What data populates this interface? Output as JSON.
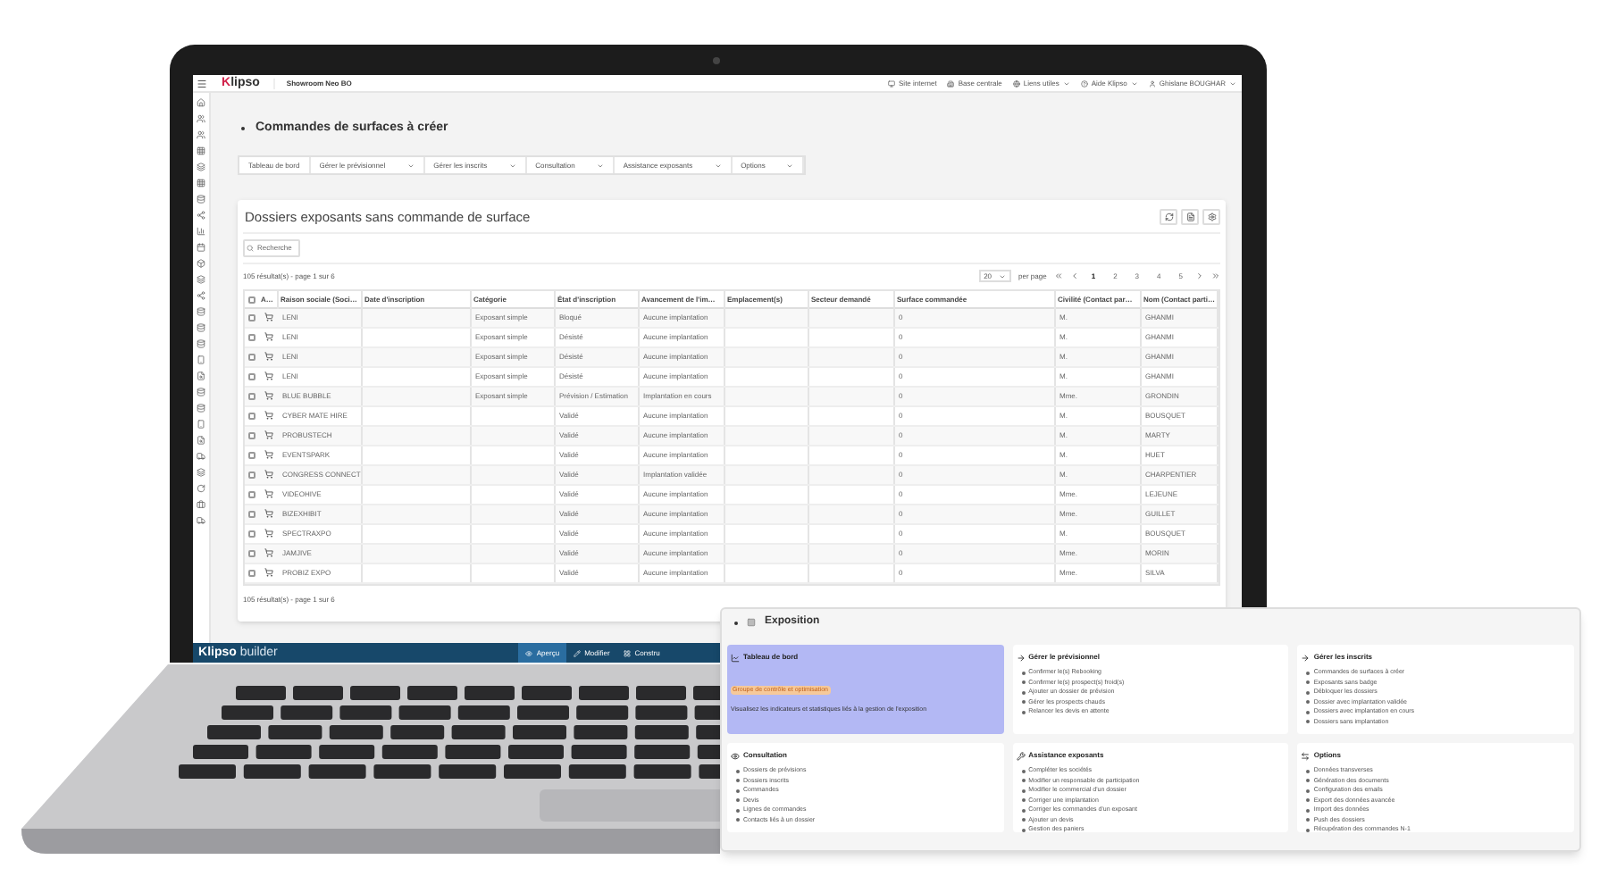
{
  "header": {
    "logo_initial": "K",
    "logo_rest": "lipso",
    "app_name": "Showroom Neo BO",
    "links": [
      {
        "label": "Site internet",
        "dropdown": false
      },
      {
        "label": "Base centrale",
        "dropdown": false
      },
      {
        "label": "Liens utiles",
        "dropdown": true
      },
      {
        "label": "Aide Klipso",
        "dropdown": true
      },
      {
        "label": "Ghislane BOUGHAR",
        "dropdown": true
      }
    ]
  },
  "page_title": "Commandes de surfaces à créer",
  "nav_tabs": [
    {
      "label": "Tableau de bord",
      "dropdown": false
    },
    {
      "label": "Gérer le prévisionnel",
      "dropdown": true
    },
    {
      "label": "Gérer les inscrits",
      "dropdown": true
    },
    {
      "label": "Consultation",
      "dropdown": true
    },
    {
      "label": "Assistance exposants",
      "dropdown": true
    },
    {
      "label": "Options",
      "dropdown": true
    }
  ],
  "card": {
    "title": "Dossiers exposants sans commande de surface",
    "search": {
      "placeholder": "Recherche"
    },
    "results": "105 résultat(s) - page 1 sur 6",
    "per_page": {
      "value": "20",
      "label": "per page"
    },
    "pages": [
      {
        "label": "1",
        "selected": true
      },
      {
        "label": "2",
        "selected": false
      },
      {
        "label": "3",
        "selected": false
      },
      {
        "label": "4",
        "selected": false
      },
      {
        "label": "5",
        "selected": false
      }
    ],
    "select_all": {
      "checked": false
    },
    "columns": [
      "A…",
      "Raison sociale (Soci…",
      "Date d'inscription",
      "Catégorie",
      "État d'inscription",
      "Avancement de l'im…",
      "Emplacement(s)",
      "Secteur demandé",
      "Surface commandée",
      "Civilité (Contact par…",
      "Nom (Contact parti…"
    ],
    "rows": [
      {
        "checked": false,
        "name": "LENI",
        "category": "Exposant simple",
        "status": "Bloqué",
        "progress": "Aucune implantation",
        "surface": "0",
        "civility": "M.",
        "contact": "GHANMI"
      },
      {
        "checked": false,
        "name": "LENI",
        "category": "Exposant simple",
        "status": "Désisté",
        "progress": "Aucune implantation",
        "surface": "0",
        "civility": "M.",
        "contact": "GHANMI"
      },
      {
        "checked": false,
        "name": "LENI",
        "category": "Exposant simple",
        "status": "Désisté",
        "progress": "Aucune implantation",
        "surface": "0",
        "civility": "M.",
        "contact": "GHANMI"
      },
      {
        "checked": false,
        "name": "LENI",
        "category": "Exposant simple",
        "status": "Désisté",
        "progress": "Aucune implantation",
        "surface": "0",
        "civility": "M.",
        "contact": "GHANMI"
      },
      {
        "checked": false,
        "name": "BLUE BUBBLE",
        "category": "Exposant simple",
        "status": "Prévision / Estimation",
        "progress": "Implantation en cours",
        "surface": "0",
        "civility": "Mme.",
        "contact": "GRONDIN"
      },
      {
        "checked": false,
        "name": "CYBER MATE HIRE",
        "status": "Validé",
        "progress": "Aucune implantation",
        "surface": "0",
        "civility": "M.",
        "contact": "BOUSQUET"
      },
      {
        "checked": false,
        "name": "PROBUSTECH",
        "status": "Validé",
        "progress": "Aucune implantation",
        "surface": "0",
        "civility": "M.",
        "contact": "MARTY"
      },
      {
        "checked": false,
        "name": "EVENTSPARK",
        "status": "Validé",
        "progress": "Aucune implantation",
        "surface": "0",
        "civility": "M.",
        "contact": "HUET"
      },
      {
        "checked": false,
        "name": "CONGRESS CONNECT",
        "status": "Validé",
        "progress": "Implantation validée",
        "surface": "0",
        "civility": "M.",
        "contact": "CHARPENTIER"
      },
      {
        "checked": false,
        "name": "VIDEOHIVE",
        "status": "Validé",
        "progress": "Aucune implantation",
        "surface": "0",
        "civility": "Mme.",
        "contact": "LEJEUNE"
      },
      {
        "checked": false,
        "name": "BIZEXHIBIT",
        "status": "Validé",
        "progress": "Aucune implantation",
        "surface": "0",
        "civility": "Mme.",
        "contact": "GUILLET"
      },
      {
        "checked": false,
        "name": "SPECTRAXPO",
        "status": "Validé",
        "progress": "Aucune implantation",
        "surface": "0",
        "civility": "M.",
        "contact": "BOUSQUET"
      },
      {
        "checked": false,
        "name": "JAMJIVE",
        "status": "Validé",
        "progress": "Aucune implantation",
        "surface": "0",
        "civility": "Mme.",
        "contact": "MORIN"
      },
      {
        "checked": false,
        "name": "PROBIZ EXPO",
        "status": "Validé",
        "progress": "Aucune implantation",
        "surface": "0",
        "civility": "Mme.",
        "contact": "SILVA"
      }
    ],
    "footer_results": "105 résultat(s) - page 1 sur 6"
  },
  "builder_bar": {
    "logo_initial": "K",
    "logo_bold": "lipso",
    "logo_rest": "builder",
    "buttons": [
      {
        "label": "Aperçu",
        "selected": true
      },
      {
        "label": "Modifier",
        "selected": false
      },
      {
        "label": "Constru",
        "selected": false
      }
    ]
  },
  "panel": {
    "title": "Exposition",
    "cards": [
      {
        "title": "Tableau de bord",
        "selected": true,
        "highlight": "Groupe de contrôle et optimisation",
        "description": "Visualisez les indicateurs et statistiques liés à la gestion de l'exposition"
      },
      {
        "title": "Gérer le prévisionnel",
        "selected": false,
        "items": [
          "Confirmer le(s) Rebooking",
          "Confirmer le(s) prospect(s) froid(s)",
          "Ajouter un dossier de prévision",
          "Gérer les prospects chauds",
          "Relancer les devis en attente"
        ]
      },
      {
        "title": "Gérer les inscrits",
        "selected": false,
        "items": [
          "Commandes de surfaces à créer",
          "Exposants sans badge",
          "Débloquer les dossiers",
          "Dossier avec implantation validée",
          "Dossiers avec implantation en cours",
          "Dossiers sans implantation"
        ]
      },
      {
        "title": "Consultation",
        "selected": false,
        "items": [
          "Dossiers de prévisions",
          "Dossiers inscrits",
          "Commandes",
          "Devis",
          "Lignes de commandes",
          "Contacts liés à un dossier"
        ]
      },
      {
        "title": "Assistance exposants",
        "selected": false,
        "items": [
          "Compléter les sociétés",
          "Modifier un responsable de participation",
          "Modifier le commercial d'un dossier",
          "Corriger une implantation",
          "Corriger les commandes d'un exposant",
          "Ajouter un devis",
          "Gestion des paniers"
        ]
      },
      {
        "title": "Options",
        "selected": false,
        "items": [
          "Données transverses",
          "Génération des documents",
          "Configuration des emails",
          "Export des données avancée",
          "Import des données",
          "Push des dossiers",
          "Récupération des commandes N-1"
        ]
      }
    ]
  }
}
